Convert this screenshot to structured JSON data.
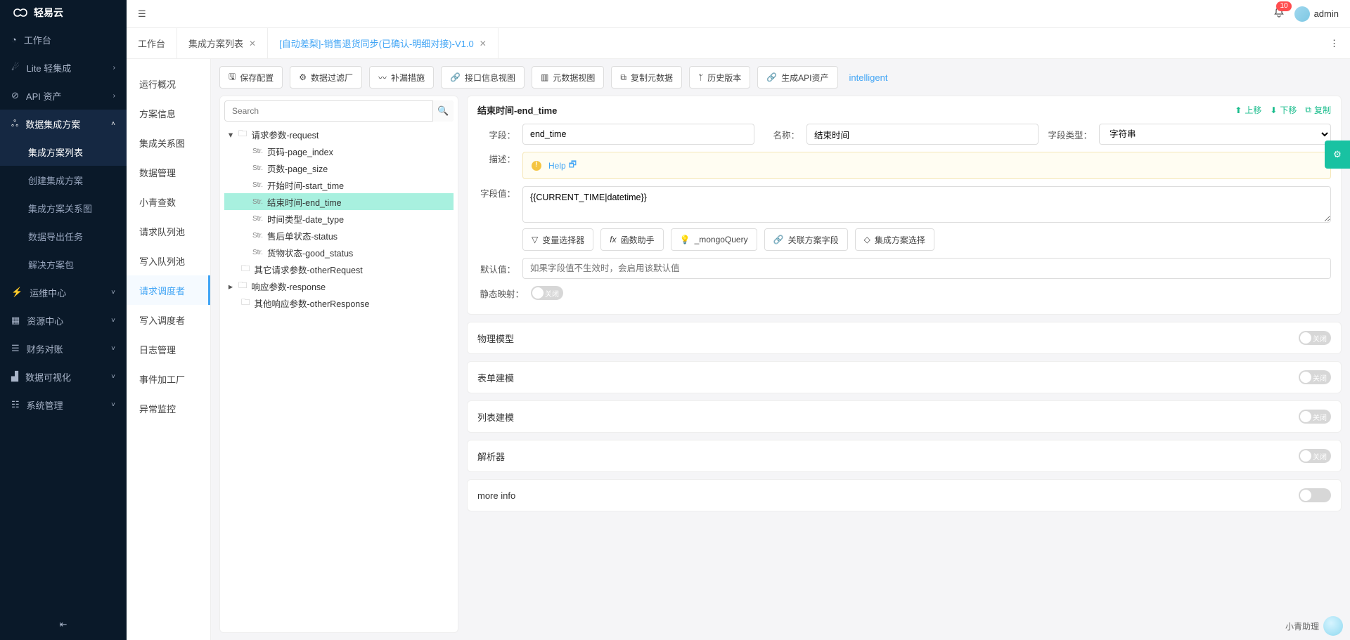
{
  "brand": {
    "name": "轻易云"
  },
  "top": {
    "notifications": "10",
    "username": "admin"
  },
  "nav": {
    "workbench": "工作台",
    "lite": "Lite 轻集成",
    "api": "API 资产",
    "dataplan": "数据集成方案",
    "sub": {
      "list": "集成方案列表",
      "create": "创建集成方案",
      "rel": "集成方案关系图",
      "export": "数据导出任务",
      "pkg": "解决方案包"
    },
    "ops": "运维中心",
    "res": "资源中心",
    "fin": "财务对账",
    "viz": "数据可视化",
    "sys": "系统管理"
  },
  "tabs": {
    "workbench": "工作台",
    "list": "集成方案列表",
    "current": "[自动差梨]-销售退货同步(已确认-明细对接)-V1.0"
  },
  "side2": {
    "overview": "运行概况",
    "plan": "方案信息",
    "relation": "集成关系图",
    "datamgr": "数据管理",
    "xq": "小青查数",
    "reqpool": "请求队列池",
    "writepool": "写入队列池",
    "reqsched": "请求调度者",
    "writesched": "写入调度者",
    "log": "日志管理",
    "event": "事件加工厂",
    "abn": "异常监控"
  },
  "toolbar": {
    "save": "保存配置",
    "filter": "数据过滤厂",
    "patch": "补漏措施",
    "ifview": "接口信息视图",
    "metaview": "元数据视图",
    "copymeta": "复制元数据",
    "history": "历史版本",
    "genapi": "生成API资产",
    "intelligent": "intelligent"
  },
  "search": {
    "placeholder": "Search"
  },
  "tree": {
    "root": "请求参数-request",
    "n1": "页码-page_index",
    "n2": "页数-page_size",
    "n3": "开始时间-start_time",
    "n4": "结束时间-end_time",
    "n5": "时间类型-date_type",
    "n6": "售后单状态-status",
    "n7": "货物状态-good_status",
    "other": "其它请求参数-otherRequest",
    "resp": "响应参数-response",
    "otherresp": "其他响应参数-otherResponse"
  },
  "form": {
    "title": "结束时间-end_time",
    "up": "上移",
    "down": "下移",
    "copy": "复制",
    "field_lbl": "字段：",
    "field_val": "end_time",
    "name_lbl": "名称：",
    "name_val": "结束时间",
    "type_lbl": "字段类型：",
    "type_val": "字符串",
    "desc_lbl": "描述：",
    "help": "Help",
    "fvalue_lbl": "字段值：",
    "fvalue": "{{CURRENT_TIME|datetime}}",
    "btns": {
      "varsel": "变量选择器",
      "func": "函数助手",
      "mongo": "_mongoQuery",
      "relfield": "关联方案字段",
      "plansel": "集成方案选择"
    },
    "default_lbl": "默认值：",
    "default_ph": "如果字段值不生效时，会启用该默认值",
    "static_lbl": "静态映射：",
    "off": "关闭",
    "acc": {
      "phys": "物理模型",
      "form": "表单建模",
      "list": "列表建模",
      "parser": "解析器",
      "more": "more info"
    }
  },
  "assistant": {
    "label": "小青助理"
  }
}
